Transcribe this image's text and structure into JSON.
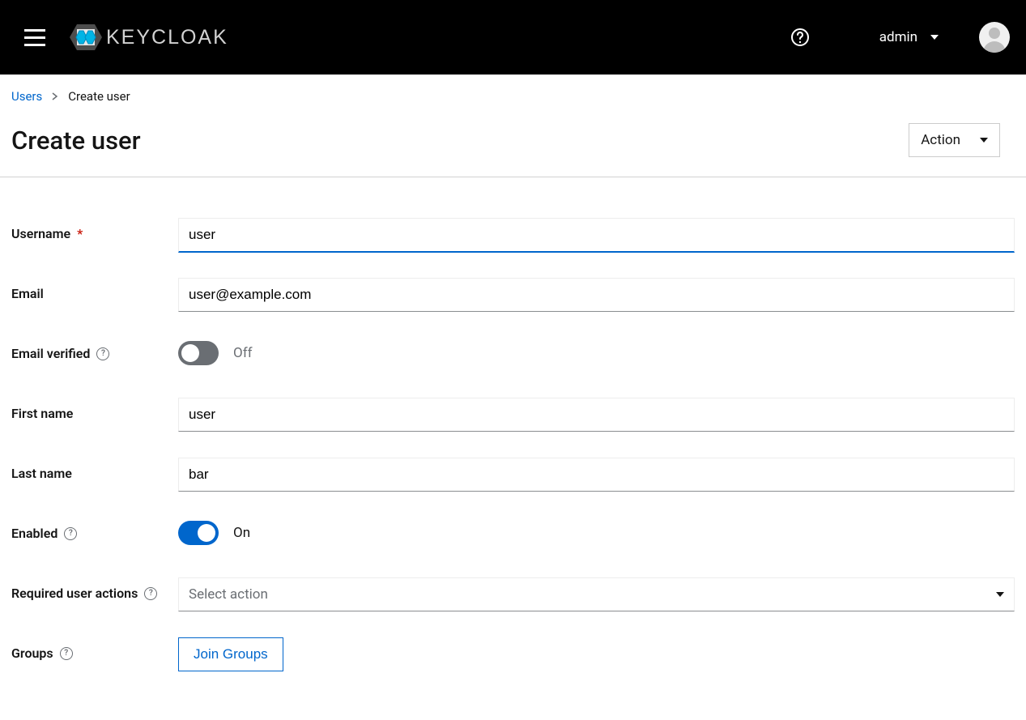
{
  "header": {
    "logo_text": "KEYCLOAK",
    "user_label": "admin"
  },
  "breadcrumb": {
    "link": "Users",
    "current": "Create user"
  },
  "page": {
    "title": "Create user",
    "action_label": "Action"
  },
  "form": {
    "username": {
      "label": "Username",
      "value": "user"
    },
    "email": {
      "label": "Email",
      "value": "user@example.com"
    },
    "email_verified": {
      "label": "Email verified",
      "state": "Off"
    },
    "first_name": {
      "label": "First name",
      "value": "user"
    },
    "last_name": {
      "label": "Last name",
      "value": "bar"
    },
    "enabled": {
      "label": "Enabled",
      "state": "On"
    },
    "required_actions": {
      "label": "Required user actions",
      "placeholder": "Select action"
    },
    "groups": {
      "label": "Groups",
      "button": "Join Groups"
    }
  }
}
